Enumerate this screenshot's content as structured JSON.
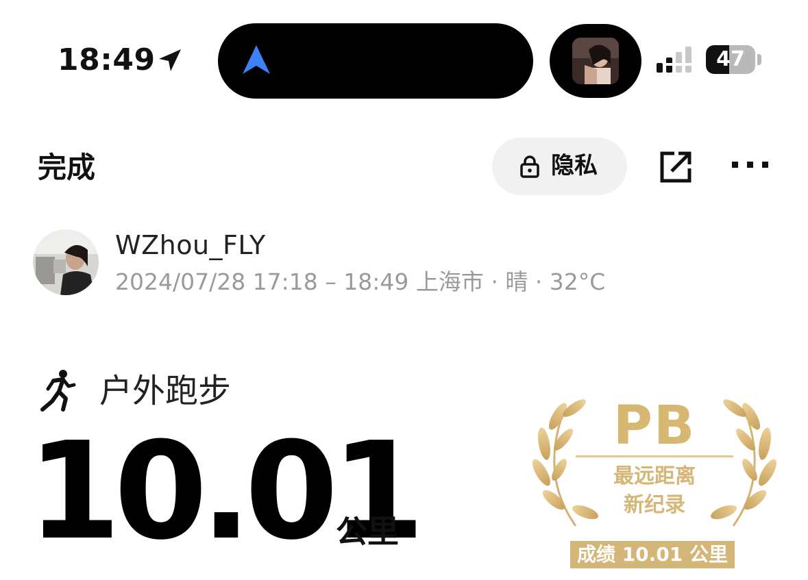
{
  "status_bar": {
    "time": "18:49",
    "battery_level": "47",
    "battery_fraction": 0.47,
    "icons": [
      "location-arrow-icon",
      "navigation-icon",
      "signal-icon",
      "battery-icon"
    ]
  },
  "header": {
    "done_label": "完成",
    "privacy_label": "隐私",
    "icons": [
      "lock-icon",
      "share-icon",
      "more-icon"
    ]
  },
  "user": {
    "name": "WZhou_FLY",
    "meta": "2024/07/28 17:18 – 18:49 上海市 · 晴 · 32°C"
  },
  "activity": {
    "type": "户外跑步",
    "distance": "10.01",
    "unit": "公里"
  },
  "badge": {
    "title": "PB",
    "subtitle_line1": "最远距离",
    "subtitle_line2": "新纪录",
    "record": "成绩 10.01 公里"
  },
  "colors": {
    "gold": "#d8b772",
    "gold_band": "#d4b679",
    "nav_blue": "#3b82f6",
    "muted_text": "#9a9a9a"
  }
}
